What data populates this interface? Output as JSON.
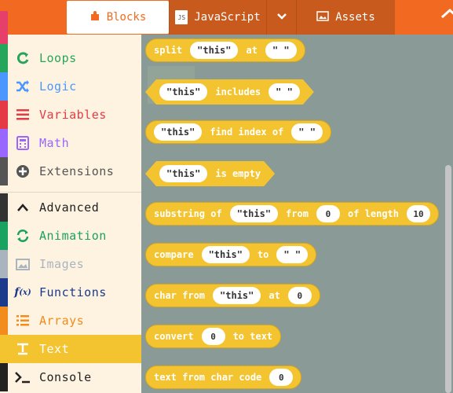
{
  "tabs": {
    "blocks": "Blocks",
    "javascript": "JavaScript",
    "assets": "Assets",
    "js_badge": "JS"
  },
  "sidebar": {
    "items": [
      {
        "label": "Loops",
        "icon": "loop-icon",
        "color": "#26a65b"
      },
      {
        "label": "Logic",
        "icon": "shuffle-icon",
        "color": "#4c97ff"
      },
      {
        "label": "Variables",
        "icon": "list-icon",
        "color": "#e63946"
      },
      {
        "label": "Math",
        "icon": "calculator-icon",
        "color": "#9966ff"
      },
      {
        "label": "Extensions",
        "icon": "plus-circle-icon",
        "color": "#555555"
      },
      {
        "label": "Advanced",
        "icon": "chevron-up-icon",
        "color": "#333333"
      },
      {
        "label": "Animation",
        "icon": "refresh-icon",
        "color": "#1aa260"
      },
      {
        "label": "Images",
        "icon": "image-icon",
        "color": "#aab4be"
      },
      {
        "label": "Functions",
        "icon": "function-icon",
        "color": "#1b3a8c"
      },
      {
        "label": "Arrays",
        "icon": "array-icon",
        "color": "#f28c1c"
      },
      {
        "label": "Text",
        "icon": "text-icon",
        "color": "#f4c430"
      },
      {
        "label": "Console",
        "icon": "terminal-icon",
        "color": "#222222"
      }
    ]
  },
  "blocks": {
    "split": {
      "label": "split",
      "str1": "\"this\"",
      "at": "at",
      "str2": "\" \""
    },
    "includes": {
      "str1": "\"this\"",
      "label": "includes",
      "str2": "\" \""
    },
    "find_index": {
      "str1": "\"this\"",
      "label": "find index of",
      "str2": "\" \""
    },
    "is_empty": {
      "str1": "\"this\"",
      "label": "is empty"
    },
    "substring": {
      "label": "substring of",
      "str1": "\"this\"",
      "from": "from",
      "n1": "0",
      "of_length": "of length",
      "n2": "10"
    },
    "compare": {
      "label": "compare",
      "str1": "\"this\"",
      "to": "to",
      "str2": "\" \""
    },
    "char_from": {
      "label": "char from",
      "str1": "\"this\"",
      "at": "at",
      "n1": "0"
    },
    "convert": {
      "label": "convert",
      "n1": "0",
      "to_text": "to text"
    },
    "from_char_code": {
      "label": "text from char code",
      "n1": "0"
    }
  },
  "colors": {
    "accent": "#f26a21",
    "block": "#f4c430",
    "workspace": "#8a9a96",
    "sidebar_bg": "#fdf3e0"
  }
}
